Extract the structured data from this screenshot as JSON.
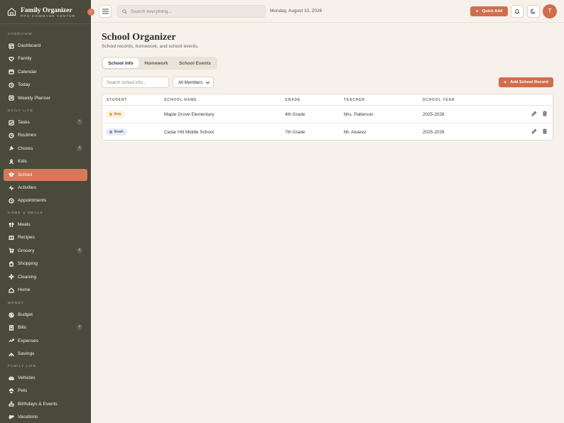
{
  "app": {
    "title": "Family Organizer",
    "subtitle": "PRO COMMAND CENTER",
    "collapse_glyph": "‹"
  },
  "sidebar": {
    "sections": [
      {
        "label": "Overview",
        "items": [
          {
            "label": "Dashboard",
            "icon": "dashboard-icon"
          },
          {
            "label": "Family",
            "icon": "family-icon"
          },
          {
            "label": "Calendar",
            "icon": "calendar-icon"
          },
          {
            "label": "Today",
            "icon": "today-icon"
          },
          {
            "label": "Weekly Planner",
            "icon": "planner-icon"
          }
        ]
      },
      {
        "label": "Daily Life",
        "items": [
          {
            "label": "Tasks",
            "icon": "tasks-icon",
            "badge": "7"
          },
          {
            "label": "Routines",
            "icon": "routines-icon"
          },
          {
            "label": "Chores",
            "icon": "chores-icon",
            "badge": "3"
          },
          {
            "label": "Kids",
            "icon": "kids-icon"
          },
          {
            "label": "School",
            "icon": "school-icon",
            "active": true
          },
          {
            "label": "Activities",
            "icon": "activities-icon"
          },
          {
            "label": "Appointments",
            "icon": "appointments-icon"
          }
        ]
      },
      {
        "label": "Home & Meals",
        "items": [
          {
            "label": "Meals",
            "icon": "meals-icon"
          },
          {
            "label": "Recipes",
            "icon": "recipes-icon"
          },
          {
            "label": "Grocery",
            "icon": "grocery-icon",
            "badge": "5"
          },
          {
            "label": "Shopping",
            "icon": "shopping-icon"
          },
          {
            "label": "Cleaning",
            "icon": "cleaning-icon"
          },
          {
            "label": "Home",
            "icon": "home-icon"
          }
        ]
      },
      {
        "label": "Money",
        "items": [
          {
            "label": "Budget",
            "icon": "budget-icon"
          },
          {
            "label": "Bills",
            "icon": "bills-icon",
            "badge": "2"
          },
          {
            "label": "Expenses",
            "icon": "expenses-icon"
          },
          {
            "label": "Savings",
            "icon": "savings-icon"
          }
        ]
      },
      {
        "label": "Family Life",
        "items": [
          {
            "label": "Vehicles",
            "icon": "vehicles-icon"
          },
          {
            "label": "Pets",
            "icon": "pets-icon"
          },
          {
            "label": "Birthdays & Events",
            "icon": "birthdays-icon"
          },
          {
            "label": "Vacations",
            "icon": "vacations-icon"
          }
        ]
      }
    ]
  },
  "topbar": {
    "search_placeholder": "Search everything...",
    "date": "Monday, August 10, 2026",
    "quick_add": "Quick Add",
    "avatar_initial": "T"
  },
  "page": {
    "title": "School Organizer",
    "subtitle": "School records, homework, and school events.",
    "tabs": [
      {
        "label": "School Info",
        "active": true
      },
      {
        "label": "Homework"
      },
      {
        "label": "School Events"
      }
    ],
    "filter_placeholder": "Search school info...",
    "member_select": "All Members",
    "add_button": "Add School Record"
  },
  "table": {
    "columns": [
      "Student",
      "School Name",
      "Grade",
      "Teacher",
      "School Year"
    ],
    "rows": [
      {
        "student": "Ava",
        "student_color": "#e6a84b",
        "chip_bg": "#fbf0dc",
        "chip_fg": "#b77a22",
        "school": "Maple Grove Elementary",
        "grade": "4th Grade",
        "teacher": "Mrs. Patterson",
        "year": "2025-2026"
      },
      {
        "student": "Noah",
        "student_color": "#7d95b8",
        "chip_bg": "#e8edf5",
        "chip_fg": "#4f6a91",
        "school": "Cedar Hill Middle School",
        "grade": "7th Grade",
        "teacher": "Mr. Alvarez",
        "year": "2025-2026"
      }
    ]
  },
  "colors": {
    "sidebar_bg": "#4a4a3c",
    "accent": "#cf6e4f",
    "page_bg": "#f6f1ea"
  }
}
